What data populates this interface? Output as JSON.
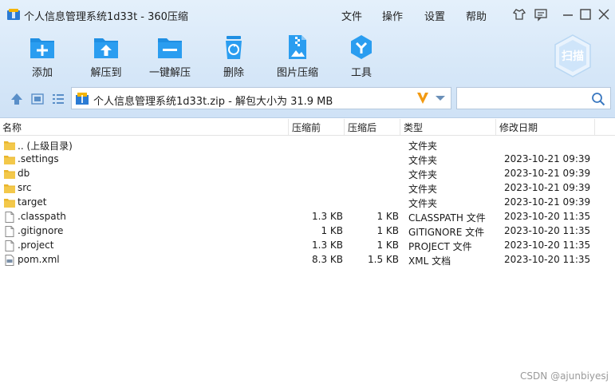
{
  "window": {
    "title": "个人信息管理系统1d33t - 360压缩",
    "menu": [
      "文件",
      "操作",
      "设置",
      "帮助"
    ]
  },
  "toolbar": {
    "add": "添加",
    "extract_to": "解压到",
    "one_click_extract": "一键解压",
    "delete": "删除",
    "image_compress": "图片压缩",
    "tools": "工具",
    "scan": "扫描"
  },
  "address": {
    "path": "个人信息管理系统1d33t.zip - 解包大小为 31.9 MB",
    "search_placeholder": ""
  },
  "columns": {
    "name": "名称",
    "before": "压缩前",
    "after": "压缩后",
    "type": "类型",
    "modified": "修改日期"
  },
  "rows": [
    {
      "name": ".. (上级目录)",
      "before": "",
      "after": "",
      "type": "文件夹",
      "modified": "",
      "icon": "folder-icon"
    },
    {
      "name": ".settings",
      "before": "",
      "after": "",
      "type": "文件夹",
      "modified": "2023-10-21 09:39",
      "icon": "folder-icon"
    },
    {
      "name": "db",
      "before": "",
      "after": "",
      "type": "文件夹",
      "modified": "2023-10-21 09:39",
      "icon": "folder-icon"
    },
    {
      "name": "src",
      "before": "",
      "after": "",
      "type": "文件夹",
      "modified": "2023-10-21 09:39",
      "icon": "folder-icon"
    },
    {
      "name": "target",
      "before": "",
      "after": "",
      "type": "文件夹",
      "modified": "2023-10-21 09:39",
      "icon": "folder-icon"
    },
    {
      "name": ".classpath",
      "before": "1.3 KB",
      "after": "1 KB",
      "type": "CLASSPATH 文件",
      "modified": "2023-10-20 11:35",
      "icon": "file-icon"
    },
    {
      "name": ".gitignore",
      "before": "1 KB",
      "after": "1 KB",
      "type": "GITIGNORE 文件",
      "modified": "2023-10-20 11:35",
      "icon": "file-icon"
    },
    {
      "name": ".project",
      "before": "1.3 KB",
      "after": "1 KB",
      "type": "PROJECT 文件",
      "modified": "2023-10-20 11:35",
      "icon": "file-icon"
    },
    {
      "name": "pom.xml",
      "before": "8.3 KB",
      "after": "1.5 KB",
      "type": "XML 文档",
      "modified": "2023-10-20 11:35",
      "icon": "xml-file-icon"
    }
  ],
  "watermark": "CSDN @ajunbiyesj",
  "colors": {
    "accent_blue": "#1f8fe3",
    "folder_yellow": "#f3c23d",
    "vip_orange": "#f29a12"
  }
}
